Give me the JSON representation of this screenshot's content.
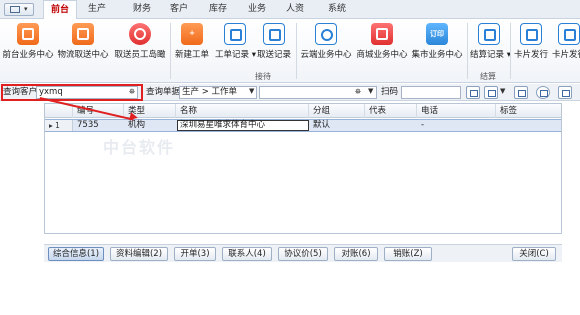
{
  "menu": {
    "tabs": [
      "前台",
      "生产",
      "财务",
      "客户",
      "库存",
      "业务",
      "人资",
      "系统"
    ],
    "active_tab": "前台"
  },
  "ribbon": {
    "buttons": [
      "前台业务中心",
      "物流取送中心",
      "取送员工岛瞰",
      "新建工单",
      "工单记录",
      "取送记录",
      "云端业务中心",
      "商城业务中心",
      "集市业务中心",
      "结算记录",
      "卡片发行",
      "卡片发行"
    ],
    "group_labels": [
      "接待",
      "结算"
    ],
    "icon_texts": [
      "",
      "",
      "",
      "",
      "",
      "",
      "",
      "",
      "订印"
    ]
  },
  "query": {
    "customer_label": "查询客户",
    "customer_value": "yxmq",
    "document_label": "查询单据",
    "document_value": "生产 > 工作单",
    "scan_label": "扫码",
    "scan_value": ""
  },
  "grid": {
    "columns": [
      "编号",
      "类型",
      "名称",
      "分组",
      "代表",
      "电话",
      "标签"
    ],
    "rows": [
      {
        "indicator": "1",
        "id": "7535",
        "type": "机构",
        "name": "深圳易星唯求体育中心",
        "group": "默认",
        "rep": "",
        "phone": "-",
        "tag": ""
      }
    ],
    "watermark": "中台软件"
  },
  "bottom_buttons": [
    "综合信息(1)",
    "资料编辑(2)",
    "开单(3)",
    "联系人(4)",
    "协议价(5)",
    "对账(6)",
    "销账(Z)",
    "关闭(C)"
  ],
  "colors": {
    "accent_red": "#e02020",
    "active_tab": "#c00000",
    "selection": "#dfe7f5"
  }
}
